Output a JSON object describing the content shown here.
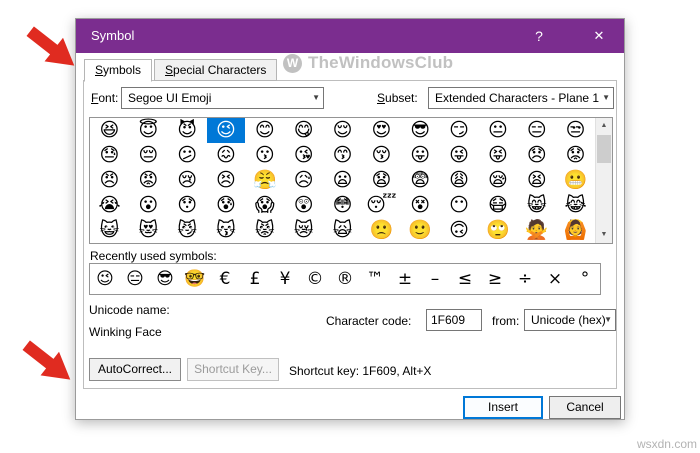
{
  "page": {
    "watermark_text": "TheWindowsClub",
    "watermark_logo_letter": "W",
    "source_watermark": "wsxdn.com"
  },
  "colors": {
    "title_bar": "#7b2d8f",
    "selection": "#0078d7",
    "annotation_arrow": "#e02b20"
  },
  "icons": {
    "help": "?",
    "close": "✕",
    "dropdown": "▼",
    "scroll_up": "▲",
    "scroll_down": "▼"
  },
  "dialog": {
    "title": "Symbol",
    "tabs": [
      {
        "label": "Symbols",
        "active": true
      },
      {
        "label": "Special Characters",
        "active": false
      }
    ],
    "font": {
      "label": "Font:",
      "value": "Segoe UI Emoji"
    },
    "subset": {
      "label": "Subset:",
      "value": "Extended Characters - Plane 1"
    },
    "grid": {
      "columns": 13,
      "selected": {
        "row": 0,
        "col": 3
      },
      "rows": [
        [
          "😆",
          "😇",
          "😈",
          "😉",
          "😊",
          "😋",
          "😌",
          "😍",
          "😎",
          "😏",
          "😐",
          "😑",
          "😒"
        ],
        [
          "😓",
          "😔",
          "😕",
          "😖",
          "😗",
          "😘",
          "😙",
          "😚",
          "😛",
          "😜",
          "😝",
          "😞",
          "😟"
        ],
        [
          "😠",
          "😡",
          "😢",
          "😣",
          "😤",
          "😥",
          "😦",
          "😧",
          "😨",
          "😩",
          "😪",
          "😫",
          "😬"
        ],
        [
          "😭",
          "😮",
          "😯",
          "😰",
          "😱",
          "😲",
          "😳",
          "😴",
          "😵",
          "😶",
          "😷",
          "😸",
          "😹"
        ],
        [
          "😺",
          "😻",
          "😼",
          "😽",
          "😾",
          "😿",
          "🙀",
          "🙁",
          "🙂",
          "🙃",
          "🙄",
          "🙅",
          "🙆"
        ]
      ]
    },
    "recent": {
      "label": "Recently used symbols:",
      "symbols": [
        "😉",
        "😑",
        "😎",
        "🤓",
        "€",
        "£",
        "¥",
        "©",
        "®",
        "™",
        "±",
        "–",
        "≤",
        "≥",
        "÷",
        "×",
        "°"
      ]
    },
    "unicode_name": {
      "label": "Unicode name:",
      "value": "Winking Face"
    },
    "char_code": {
      "label": "Character code:",
      "value": "1F609"
    },
    "from": {
      "label": "from:",
      "value": "Unicode (hex)"
    },
    "shortcut_text": "Shortcut key: 1F609, Alt+X",
    "buttons": {
      "autocorrect": "AutoCorrect...",
      "shortcut_key": "Shortcut Key...",
      "insert": "Insert",
      "cancel": "Cancel"
    }
  }
}
